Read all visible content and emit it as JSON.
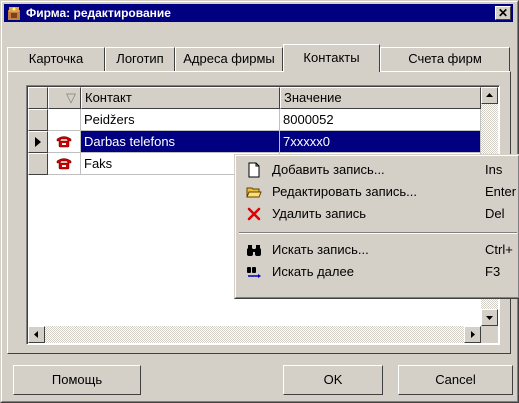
{
  "window": {
    "title": "Фирма: редактирование",
    "close_label": "✕"
  },
  "tabs": [
    {
      "label": "Карточка"
    },
    {
      "label": "Логотип"
    },
    {
      "label": "Адреса фирмы"
    },
    {
      "label": "Контакты"
    },
    {
      "label": "Счета фирм"
    }
  ],
  "active_tab": "Контакты",
  "grid": {
    "columns": [
      "Контакт",
      "Значение"
    ],
    "sort_indicator": "▽",
    "rows": [
      {
        "icon": "",
        "contact": "Peidžers",
        "value": "8000052",
        "selected": false
      },
      {
        "icon": "phone-icon",
        "contact": "Darbas telefons",
        "value": "7xxxxx0",
        "selected": true
      },
      {
        "icon": "phone-icon",
        "contact": "Faks",
        "value": "",
        "selected": false
      }
    ]
  },
  "context_menu": {
    "items": [
      {
        "label": "Добавить запись...",
        "shortcut": "Ins",
        "icon": "new-document-icon"
      },
      {
        "label": "Редактировать запись...",
        "shortcut": "Enter",
        "icon": "open-folder-icon"
      },
      {
        "label": "Удалить запись",
        "shortcut": "Del",
        "icon": "delete-x-icon"
      },
      {
        "label": "Искать запись...",
        "shortcut": "Ctrl+",
        "icon": "binoculars-icon"
      },
      {
        "label": "Искать далее",
        "shortcut": "F3",
        "icon": "find-next-icon"
      }
    ]
  },
  "buttons": {
    "help": "Помощь",
    "ok": "OK",
    "cancel": "Cancel"
  },
  "colors": {
    "selection": "#000080",
    "titlebar": "#000080",
    "face": "#d4d0c8",
    "delete_icon": "#e00000",
    "phone_icon": "#cc0000"
  }
}
